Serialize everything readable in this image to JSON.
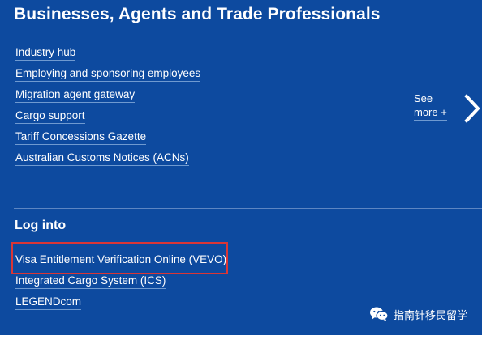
{
  "section": {
    "title": "Businesses, Agents and Trade Professionals",
    "links": [
      {
        "label": "Industry hub"
      },
      {
        "label": "Employing and sponsoring employees"
      },
      {
        "label": "Migration agent gateway"
      },
      {
        "label": "Cargo support"
      },
      {
        "label": "Tariff Concessions Gazette"
      },
      {
        "label": "Australian Customs Notices (ACNs)"
      }
    ],
    "see_more": {
      "line1": "See",
      "line2": "more +"
    }
  },
  "login": {
    "title": "Log into",
    "links": [
      {
        "label": "Visa Entitlement Verification Online (VEVO)",
        "highlighted": true
      },
      {
        "label": "Integrated Cargo System (ICS)"
      },
      {
        "label": "LEGENDcom"
      }
    ]
  },
  "watermark": {
    "text": "指南针移民留学",
    "icon": "wechat-icon"
  },
  "colors": {
    "panel_background": "#0d4a9f",
    "text": "#ffffff",
    "link_underline": "#6f9ad0",
    "highlight_border": "#d93636"
  }
}
